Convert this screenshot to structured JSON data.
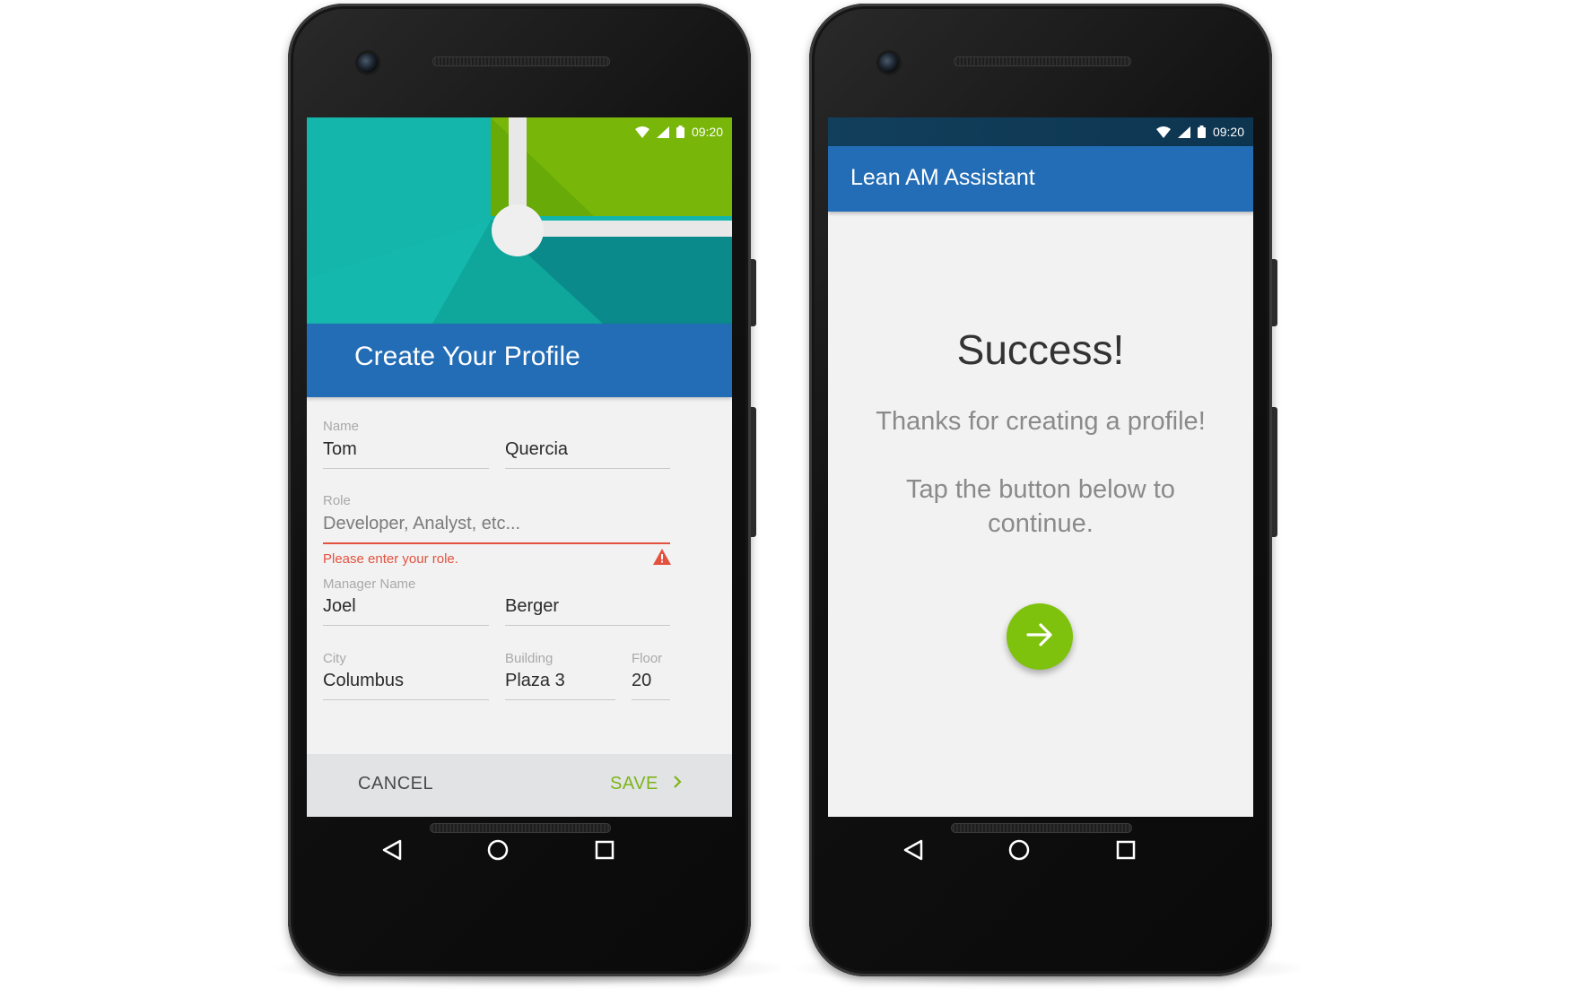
{
  "left_phone": {
    "status_bar": {
      "time": "09:20"
    },
    "header": {
      "title": "Create Your Profile"
    },
    "form": {
      "name": {
        "label": "Name",
        "first": "Tom",
        "last": "Quercia"
      },
      "role": {
        "label": "Role",
        "placeholder": "Developer, Analyst, etc...",
        "error": "Please enter your role."
      },
      "manager": {
        "label": "Manager Name",
        "first": "Joel",
        "last": "Berger"
      },
      "city": {
        "label": "City",
        "value": "Columbus"
      },
      "building": {
        "label": "Building",
        "value": "Plaza 3"
      },
      "floor": {
        "label": "Floor",
        "value": "20"
      }
    },
    "actions": {
      "cancel": "CANCEL",
      "save": "SAVE"
    }
  },
  "right_phone": {
    "status_bar": {
      "time": "09:20"
    },
    "app_bar": {
      "title": "Lean AM Assistant"
    },
    "content": {
      "heading": "Success!",
      "message_1": "Thanks for creating a profile!",
      "message_2_line_1": "Tap the button below to",
      "message_2_line_2": "continue."
    },
    "fab_icon": "arrow-right-icon"
  },
  "nav_icons": [
    "back-icon",
    "home-icon",
    "recents-icon"
  ],
  "colors": {
    "primary_blue": "#236db6",
    "accent_green": "#7ec20d",
    "save_green": "#7cb518",
    "error_red": "#e4513f",
    "teal": "#12b3a9"
  }
}
